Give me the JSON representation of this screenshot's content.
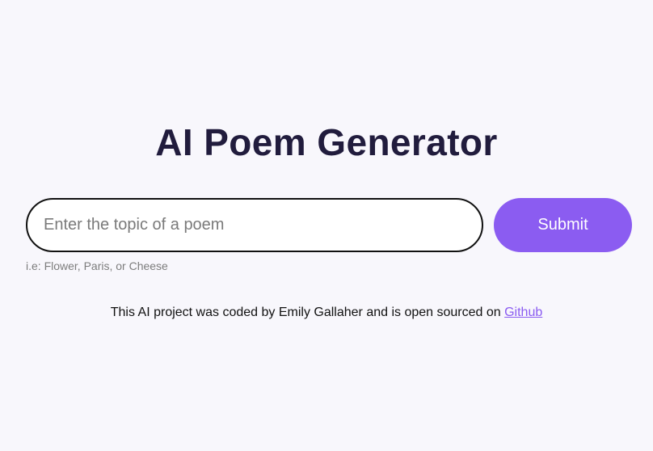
{
  "title": "AI Poem Generator",
  "form": {
    "input_value": "",
    "input_placeholder": "Enter the topic of a poem",
    "submit_label": "Submit",
    "hint": "i.e: Flower, Paris, or Cheese"
  },
  "footer": {
    "text": "This AI project was coded by Emily Gallaher and is open sourced on ",
    "link_label": "Github"
  },
  "colors": {
    "background": "#f8f7fc",
    "title": "#211c3d",
    "accent": "#8b5cf1"
  }
}
